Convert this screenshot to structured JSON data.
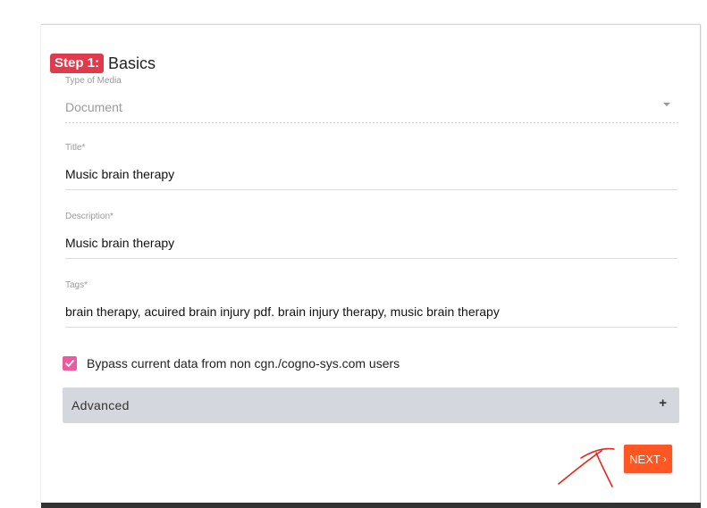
{
  "heading": {
    "step_badge": "Step 1:",
    "title": "Basics"
  },
  "fields": {
    "media_type": {
      "label": "Type of Media",
      "value": "Document"
    },
    "title": {
      "label": "Title*",
      "value": "Music brain therapy"
    },
    "description": {
      "label": "Description*",
      "value": "Music brain therapy"
    },
    "tags": {
      "label": "Tags*",
      "value": "brain therapy, acuired brain injury pdf. brain injury therapy, music brain  therapy"
    }
  },
  "bypass": {
    "label": "Bypass current data from non cgn./cogno-sys.com users",
    "checked": true
  },
  "advanced": {
    "label": "Advanced",
    "icon": "plus-icon"
  },
  "next_button": {
    "label": "NEXT",
    "icon": "chevron-right-icon"
  },
  "colors": {
    "step_badge": "#e03a4d",
    "checkbox": "#ee5aa0",
    "next_button": "#ff5622",
    "accordion_bg": "#d4d7dd",
    "annotation": "#e8251c"
  }
}
